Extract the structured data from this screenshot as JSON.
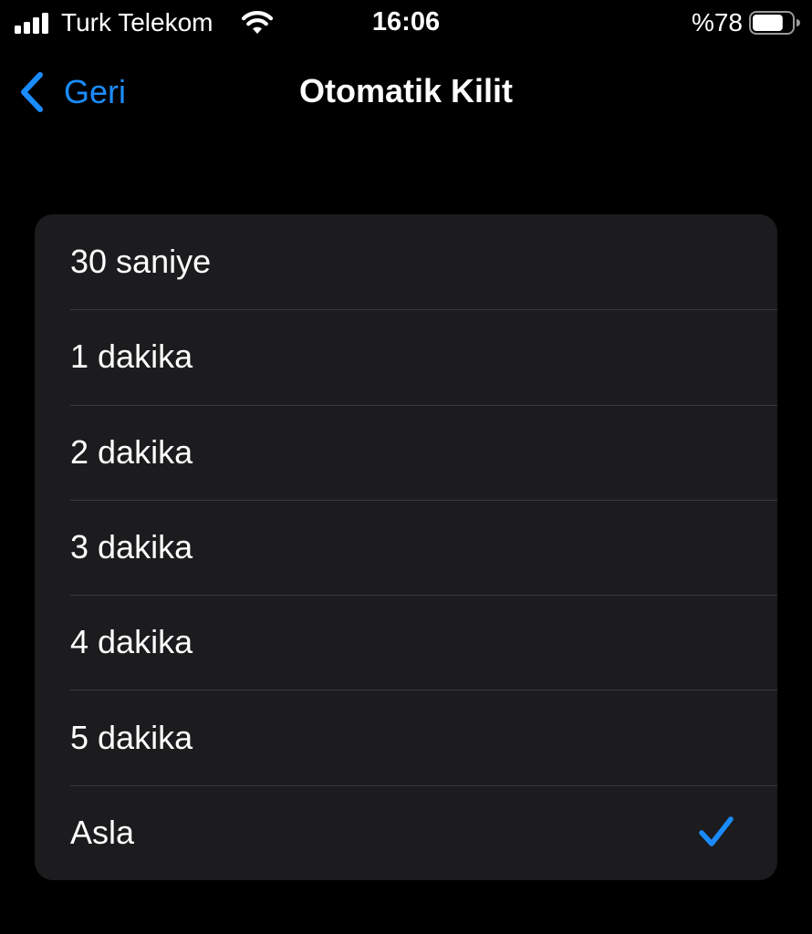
{
  "status_bar": {
    "carrier": "Turk Telekom",
    "time": "16:06",
    "battery_text": "%78",
    "battery_level": 0.78,
    "signal_bars": 4,
    "icons": [
      "signal-icon",
      "wifi-icon",
      "battery-icon"
    ]
  },
  "nav": {
    "back_label": "Geri",
    "title": "Otomatik Kilit",
    "back_icon": "chevron-left-icon"
  },
  "options": [
    {
      "label": "30 saniye",
      "selected": false
    },
    {
      "label": "1 dakika",
      "selected": false
    },
    {
      "label": "2 dakika",
      "selected": false
    },
    {
      "label": "3 dakika",
      "selected": false
    },
    {
      "label": "4 dakika",
      "selected": false
    },
    {
      "label": "5 dakika",
      "selected": false
    },
    {
      "label": "Asla",
      "selected": true
    }
  ],
  "colors": {
    "accent": "#1a8cff",
    "background": "#000000",
    "group_background": "#1c1c1e",
    "separator": "#38383a",
    "text": "#ffffff"
  }
}
